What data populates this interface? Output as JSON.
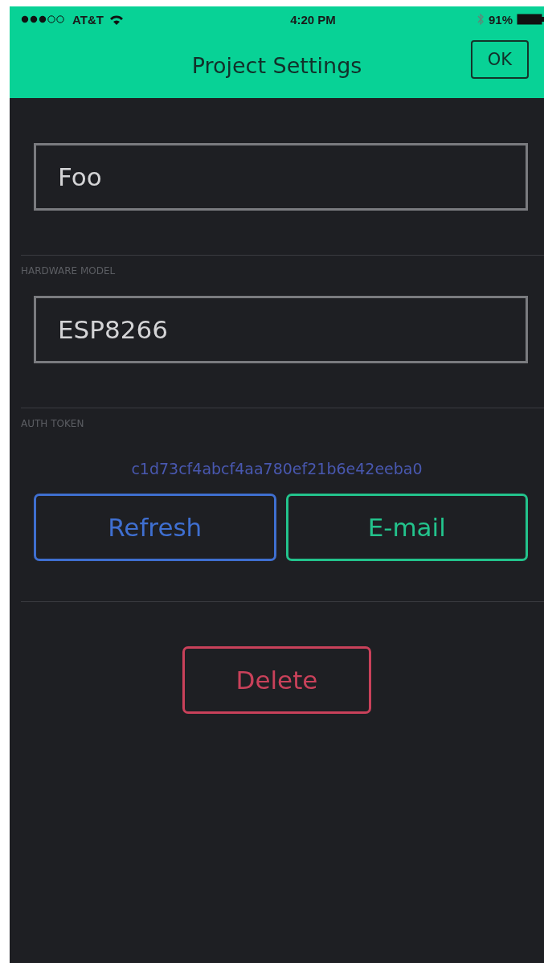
{
  "status_bar": {
    "carrier": "AT&T",
    "time": "4:20 PM",
    "battery": "91%"
  },
  "nav_bar": {
    "title": "Project Settings",
    "action": "OK"
  },
  "sections": [
    {
      "kind": "field",
      "value": "Foo"
    },
    {
      "kind": "field",
      "label": "HARDWARE MODEL",
      "value": "ESP8266"
    },
    {
      "kind": "token",
      "label": "AUTH TOKEN",
      "token": "c1d73cf4abcf4aa780ef21b6e42eeba0",
      "buttons": [
        {
          "label": "Refresh",
          "color": "#3f6fd0"
        },
        {
          "label": "E-mail",
          "color": "#23c38c"
        }
      ]
    },
    {
      "kind": "danger",
      "buttons": [
        {
          "label": "Delete",
          "color": "#c9415a"
        }
      ]
    }
  ]
}
